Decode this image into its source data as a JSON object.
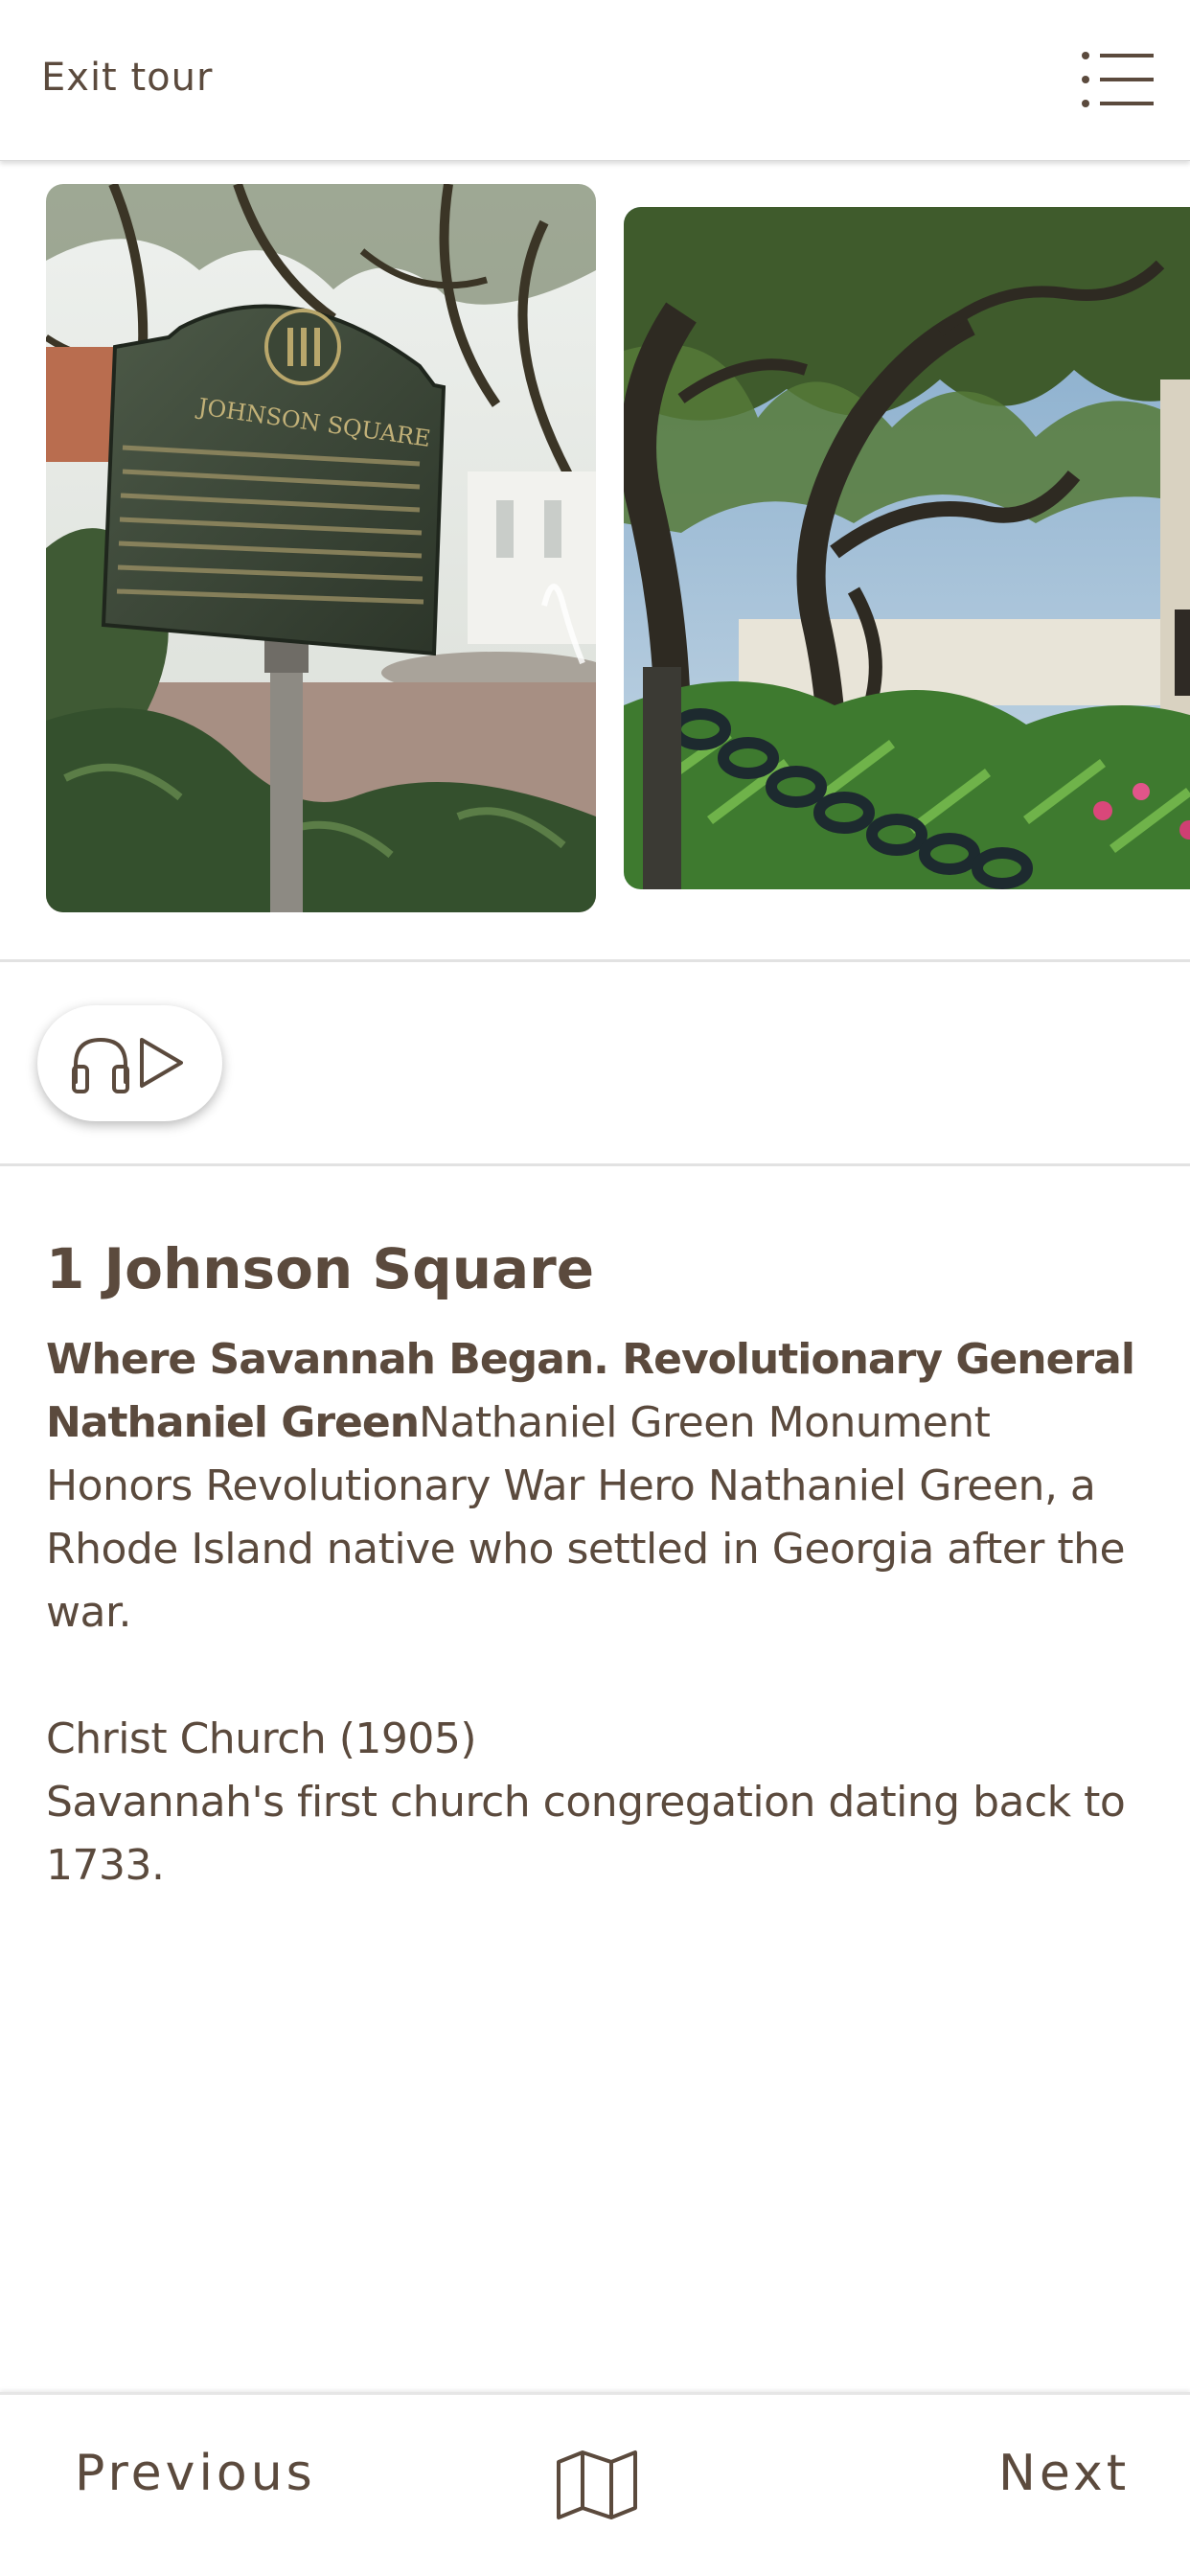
{
  "header": {
    "exit_label": "Exit tour",
    "menu_icon": "list-menu-icon"
  },
  "gallery": {
    "photos": [
      {
        "name": "johnson-square-historical-marker-photo",
        "marker_heading": "JOHNSON SQUARE"
      },
      {
        "name": "oak-trees-square-photo"
      }
    ]
  },
  "audio": {
    "icons": [
      "headphones-icon",
      "play-icon"
    ]
  },
  "stop": {
    "title": "1 Johnson Square",
    "lead": "Where Savannah Began. Revolutionary General Nathaniel Green",
    "line1": "Nathaniel Green Monument",
    "line2": "Honors Revolutionary War Hero Nathaniel Green, a Rhode Island native who settled in Georgia after the war.",
    "line3": "Christ Church (1905)",
    "line4": "Savannah's first church congregation dating back to 1733."
  },
  "footer": {
    "previous_label": "Previous",
    "next_label": "Next",
    "map_icon": "map-icon"
  },
  "colors": {
    "text": "#5b4a3d",
    "divider": "#e2e2e2",
    "background": "#ffffff"
  }
}
